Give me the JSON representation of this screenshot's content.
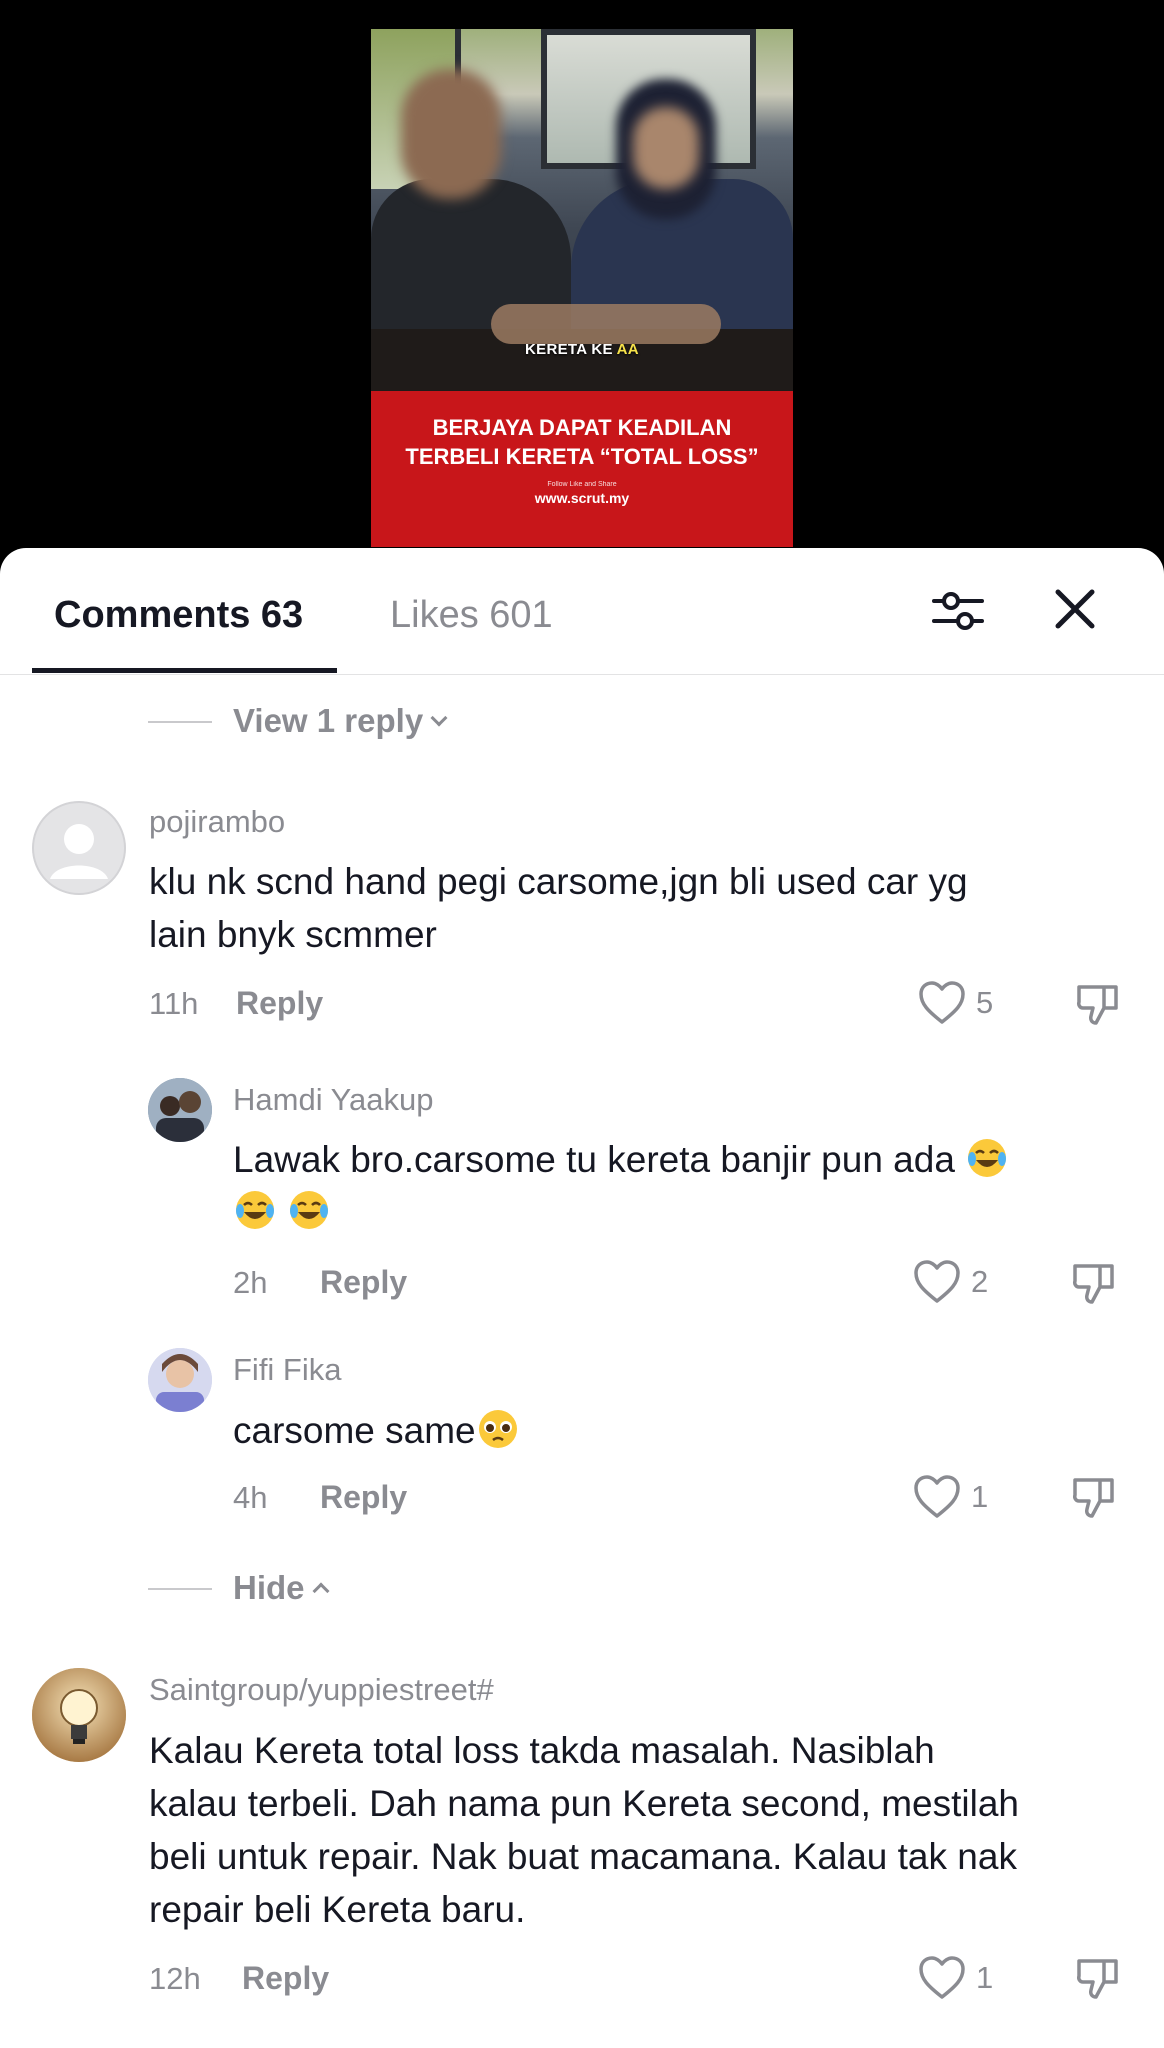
{
  "video": {
    "caption_prefix": "KERETA KE ",
    "caption_highlight": "AA",
    "banner_line1": "BERJAYA DAPAT KEADILAN",
    "banner_line2": "TERBELI KERETA “TOTAL LOSS”",
    "banner_small": "Follow Like and Share",
    "banner_site": "www.scrut.my"
  },
  "tabs": {
    "comments_label": "Comments 63",
    "likes_label": "Likes 601"
  },
  "view_reply": "View 1 reply",
  "hide_label": "Hide",
  "comments": [
    {
      "username": "pojirambo",
      "text_line1": "klu nk scnd hand pegi carsome,jgn bli used car yg",
      "text_line2": "lain bnyk scmmer",
      "time": "11h",
      "reply": "Reply",
      "likes": "5"
    },
    {
      "username": "Hamdi Yaakup",
      "text_line1": "Lawak bro.carsome tu kereta banjir pun ada",
      "time": "2h",
      "reply": "Reply",
      "likes": "2"
    },
    {
      "username": "Fifi Fika",
      "text_line1": "carsome same",
      "time": "4h",
      "reply": "Reply",
      "likes": "1"
    },
    {
      "username": "Saintgroup/yuppiestreet#",
      "text_line1": "Kalau Kereta total loss takda masalah. Nasiblah",
      "text_line2": "kalau terbeli. Dah nama pun Kereta second, mestilah",
      "text_line3": "beli untuk repair. Nak buat macamana. Kalau tak nak",
      "text_line4": "repair beli Kereta baru.",
      "time": "12h",
      "reply": "Reply",
      "likes": "1"
    }
  ],
  "colors": {
    "accent_text": "#161823",
    "muted": "#8a8b91",
    "banner_red": "#c8161a"
  },
  "icons": [
    "filter-icon",
    "close-icon",
    "heart-icon",
    "dislike-icon",
    "tears-of-joy-emoji",
    "pleading-face-emoji"
  ]
}
